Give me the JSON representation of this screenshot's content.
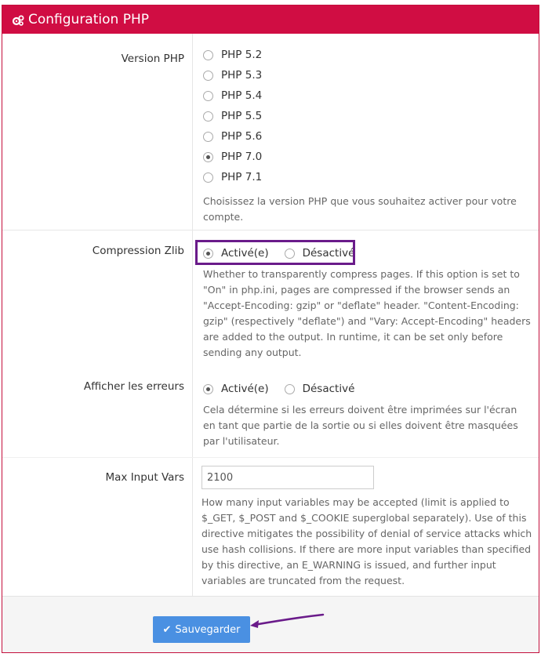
{
  "header": {
    "title": "Configuration PHP",
    "icon": "cogs-icon",
    "color": "#d00d43"
  },
  "php_version": {
    "label": "Version PHP",
    "options": [
      "PHP 5.2",
      "PHP 5.3",
      "PHP 5.4",
      "PHP 5.5",
      "PHP 5.6",
      "PHP 7.0",
      "PHP 7.1"
    ],
    "selected": "PHP 7.0",
    "help": "Choisissez la version PHP que vous souhaitez activer pour votre compte."
  },
  "zlib": {
    "label": "Compression Zlib",
    "on_label": "Activé(e)",
    "off_label": "Désactivé",
    "selected": "Activé(e)",
    "help": "Whether to transparently compress pages. If this option is set to \"On\" in php.ini, pages are compressed if the browser sends an \"Accept-Encoding: gzip\" or \"deflate\" header. \"Content-Encoding: gzip\" (respectively \"deflate\") and \"Vary: Accept-Encoding\" headers are added to the output. In runtime, it can be set only before sending any output."
  },
  "errors": {
    "label": "Afficher les erreurs",
    "on_label": "Activé(e)",
    "off_label": "Désactivé",
    "selected": "Activé(e)",
    "help": "Cela détermine si les erreurs doivent être imprimées sur l'écran en tant que partie de la sortie ou si elles doivent être masquées par l'utilisateur."
  },
  "max_input_vars": {
    "label": "Max Input Vars",
    "value": "2100",
    "help": "How many input variables may be accepted (limit is applied to $_GET, $_POST and $_COOKIE superglobal separately). Use of this directive mitigates the possibility of denial of service attacks which use hash collisions. If there are more input variables than specified by this directive, an E_WARNING is issued, and further input variables are truncated from the request."
  },
  "footer": {
    "save_label": "Sauvegarder",
    "save_color": "#4a90e2"
  },
  "annotation_color": "#6a1b8a"
}
